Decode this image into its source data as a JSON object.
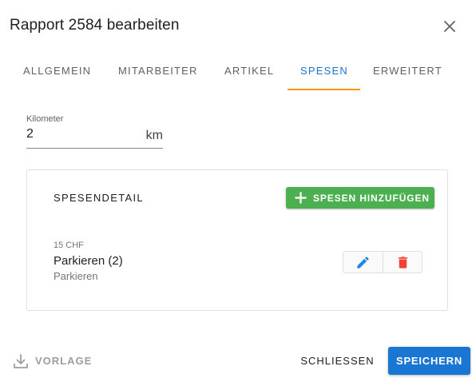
{
  "dialog": {
    "title": "Rapport 2584 bearbeiten",
    "close_icon": "close-icon"
  },
  "tabs": [
    {
      "label": "ALLGEMEIN",
      "active": false
    },
    {
      "label": "MITARBEITER",
      "active": false
    },
    {
      "label": "ARTIKEL",
      "active": false
    },
    {
      "label": "SPESEN",
      "active": true
    },
    {
      "label": "ERWEITERT",
      "active": false
    }
  ],
  "kilometer": {
    "label": "Kilometer",
    "value": "2",
    "suffix": "km"
  },
  "spesen": {
    "title": "SPESENDETAIL",
    "add_label": "SPESEN HINZUFÜGEN",
    "items": [
      {
        "price": "15 CHF",
        "name": "Parkieren (2)",
        "category": "Parkieren"
      }
    ]
  },
  "footer": {
    "vorlage_label": "VORLAGE",
    "close_label": "SCHLIESSEN",
    "save_label": "SPEICHERN"
  },
  "colors": {
    "primary": "#1976d2",
    "tab_indicator": "#ff9800",
    "add_button": "#4caf50",
    "edit_icon": "#1e88e5",
    "delete_icon": "#f44336"
  }
}
